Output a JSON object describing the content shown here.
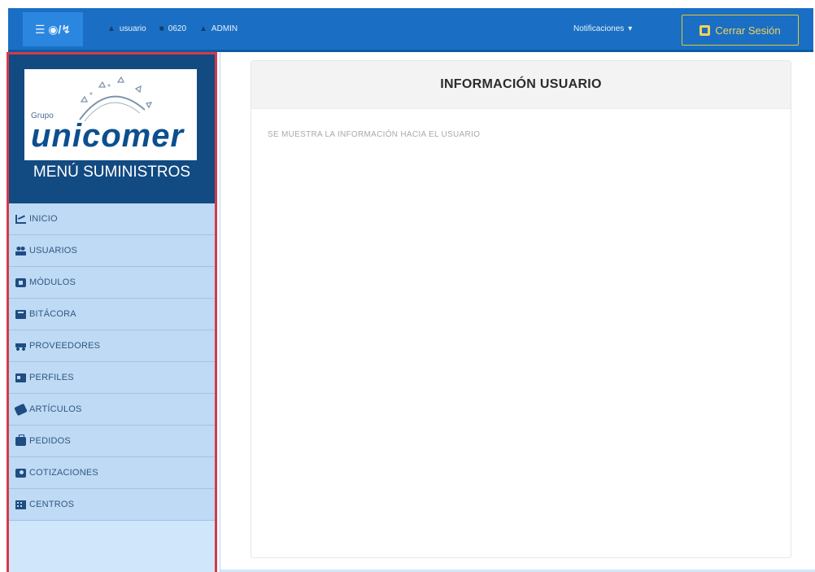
{
  "header": {
    "toggle_icons": "☰ ◉/↯",
    "username": "usuario",
    "code": "0620",
    "role": "ADMIN",
    "notifications_label": "Notificaciones",
    "notifications_caret": "▾",
    "logout_label": "Cerrar Sesión"
  },
  "sidebar": {
    "logo_small": "Grupo",
    "logo_big": "unicomer",
    "title": "MENÚ SUMINISTROS",
    "items": [
      {
        "label": "INICIO",
        "icon": "chart-line-icon"
      },
      {
        "label": "USUARIOS",
        "icon": "users-icon"
      },
      {
        "label": "MÓDULOS",
        "icon": "module-icon"
      },
      {
        "label": "BITÁCORA",
        "icon": "book-icon"
      },
      {
        "label": "PROVEEDORES",
        "icon": "truck-icon"
      },
      {
        "label": "PERFILES",
        "icon": "id-card-icon"
      },
      {
        "label": "ARTÍCULOS",
        "icon": "pencil-icon"
      },
      {
        "label": "PEDIDOS",
        "icon": "briefcase-icon"
      },
      {
        "label": "COTIZACIONES",
        "icon": "money-icon"
      },
      {
        "label": "CENTROS",
        "icon": "building-icon"
      }
    ]
  },
  "main": {
    "card_title": "INFORMACIÓN USUARIO",
    "card_text": "SE MUESTRA LA INFORMACIÓN HACIA EL USUARIO"
  },
  "colors": {
    "navbar": "#1a6fc4",
    "sidebar_brand": "#124a82",
    "sidebar_item": "#bfdaf5",
    "sidebar_border": "#d23b4a",
    "logout_accent": "#f0d35a"
  }
}
